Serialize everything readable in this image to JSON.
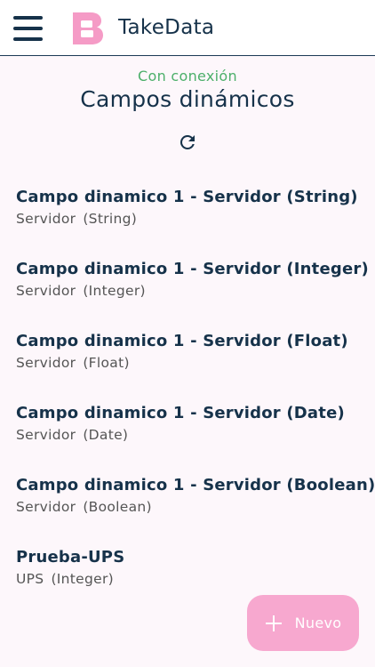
{
  "appbar": {
    "app_title": "TakeData"
  },
  "header": {
    "status": "Con conexión",
    "title": "Campos dinámicos"
  },
  "items": [
    {
      "title": "Campo dinamico 1 - Servidor (String)",
      "source": "Servidor",
      "type": "(String)"
    },
    {
      "title": "Campo dinamico 1 - Servidor (Integer)",
      "source": "Servidor",
      "type": "(Integer)"
    },
    {
      "title": "Campo dinamico 1 - Servidor (Float)",
      "source": "Servidor",
      "type": "(Float)"
    },
    {
      "title": "Campo dinamico 1 - Servidor (Date)",
      "source": "Servidor",
      "type": "(Date)"
    },
    {
      "title": "Campo dinamico 1 - Servidor (Boolean)",
      "source": "Servidor",
      "type": "(Boolean)"
    },
    {
      "title": "Prueba-UPS",
      "source": "UPS",
      "type": "(Integer)"
    }
  ],
  "fab": {
    "label": "Nuevo",
    "icon": "plus-icon"
  },
  "colors": {
    "primary": "#16324a",
    "status_online": "#4caf6a",
    "brand_pink": "#f7a8cf",
    "background": "#fdf7fb"
  }
}
